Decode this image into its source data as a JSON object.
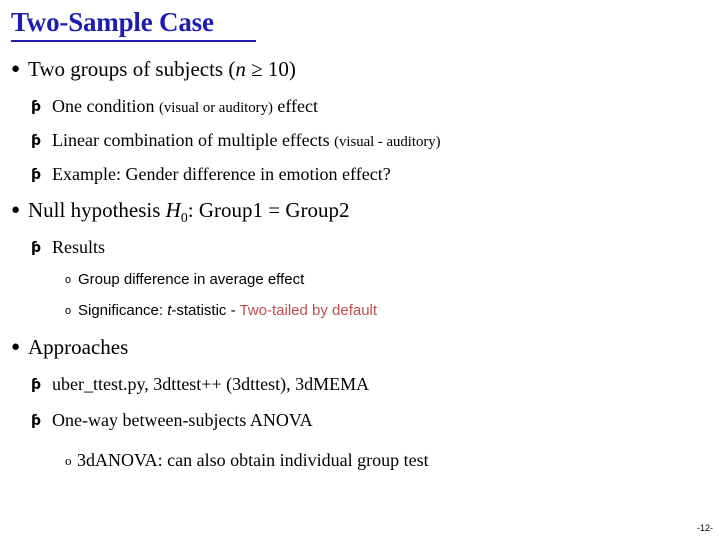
{
  "slide": {
    "title": "Two-Sample Case",
    "page_number": "-12-",
    "title_color": "#1d1db4",
    "accent_red": "#bf4c4a",
    "bullet_markers": {
      "level1": "●",
      "level2": "ƥ",
      "level3": "o"
    },
    "bullets": {
      "b1_text": "Two groups of subjects (",
      "b1_italic_n": "n",
      "b1_tail": " ≥ 10)",
      "b1s1_text": "One condition ",
      "b1s1_small": "(visual or auditory)",
      "b1s1_tail": " effect",
      "b1s2_text": "Linear combination of multiple effects ",
      "b1s2_small": "(visual - auditory)",
      "b1s3_text": "Example: Gender difference in emotion effect?",
      "b2_lead": "Null hypothesis ",
      "b2_italic_h": "H",
      "b2_sub": "0",
      "b2_tail": ": Group1 = Group2",
      "b2s1_text": "Results",
      "b2s1a_text": "Group difference in average effect",
      "b2s1b_lead": "Significance: ",
      "b2s1b_italic_t": "t",
      "b2s1b_mid": "-statistic - ",
      "b2s1b_red": "Two-tailed by default",
      "b3_text": "Approaches",
      "b3s1_text": "uber_ttest.py, 3dttest++ (3dttest), 3dMEMA",
      "b3s2_text": "One-way between-subjects ANOVA",
      "b3s2a_text": "3dANOVA: can also obtain individual group test"
    }
  }
}
